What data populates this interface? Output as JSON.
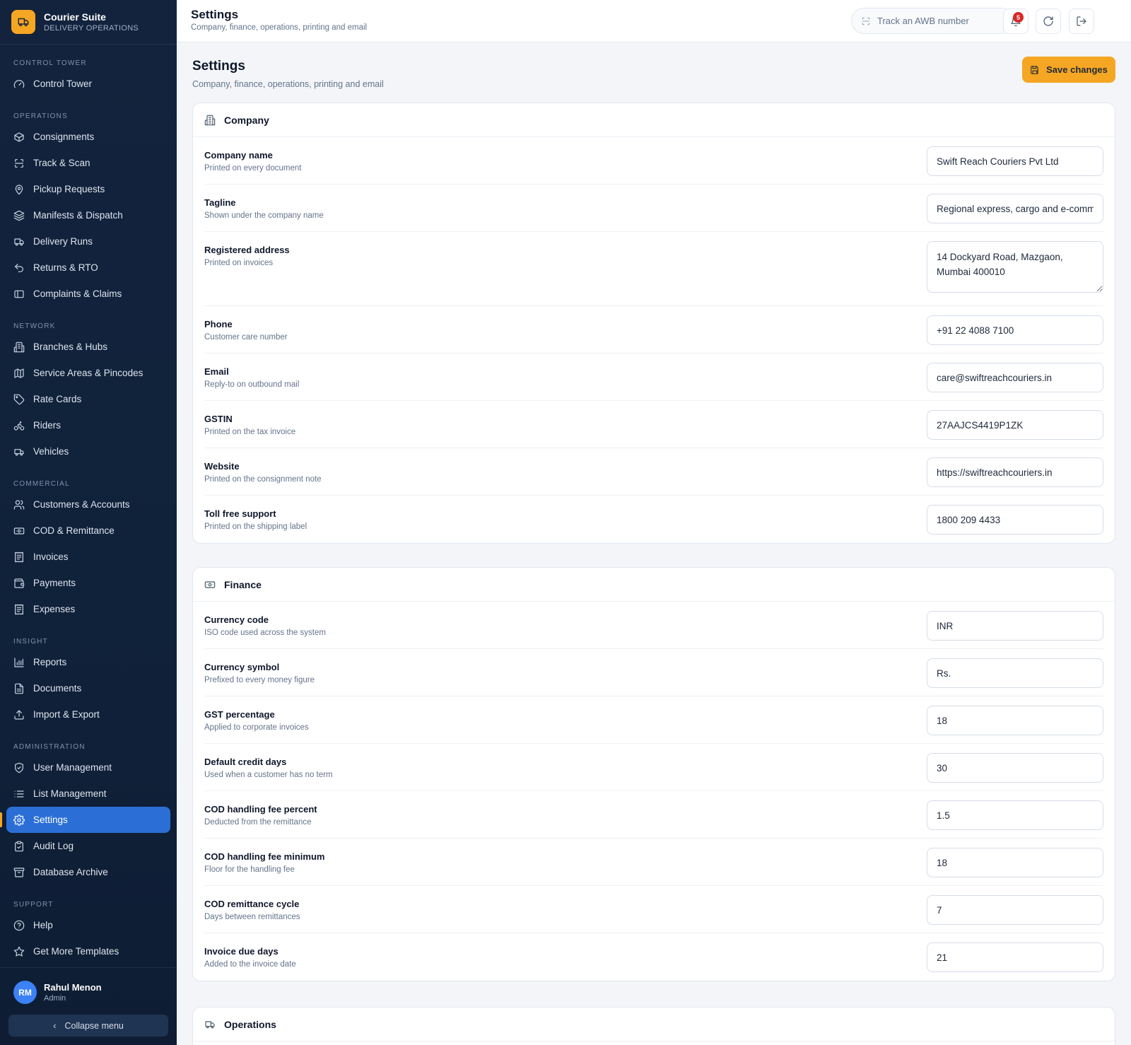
{
  "brand": {
    "name": "Courier Suite",
    "subtitle": "DELIVERY OPERATIONS"
  },
  "nav": {
    "sections": [
      {
        "label": "CONTROL TOWER",
        "items": [
          {
            "label": "Control Tower",
            "icon": "gauge-icon"
          }
        ]
      },
      {
        "label": "OPERATIONS",
        "items": [
          {
            "label": "Consignments",
            "icon": "package-icon"
          },
          {
            "label": "Track & Scan",
            "icon": "scan-icon"
          },
          {
            "label": "Pickup Requests",
            "icon": "map-pin-icon"
          },
          {
            "label": "Manifests & Dispatch",
            "icon": "layers-icon"
          },
          {
            "label": "Delivery Runs",
            "icon": "truck-icon"
          },
          {
            "label": "Returns & RTO",
            "icon": "undo-icon"
          },
          {
            "label": "Complaints & Claims",
            "icon": "ticket-icon"
          }
        ]
      },
      {
        "label": "NETWORK",
        "items": [
          {
            "label": "Branches & Hubs",
            "icon": "building-icon"
          },
          {
            "label": "Service Areas & Pincodes",
            "icon": "map-icon"
          },
          {
            "label": "Rate Cards",
            "icon": "tag-icon"
          },
          {
            "label": "Riders",
            "icon": "bike-icon"
          },
          {
            "label": "Vehicles",
            "icon": "van-icon"
          }
        ]
      },
      {
        "label": "COMMERCIAL",
        "items": [
          {
            "label": "Customers & Accounts",
            "icon": "users-icon"
          },
          {
            "label": "COD & Remittance",
            "icon": "banknote-icon"
          },
          {
            "label": "Invoices",
            "icon": "receipt-icon"
          },
          {
            "label": "Payments",
            "icon": "wallet-icon"
          },
          {
            "label": "Expenses",
            "icon": "receipt-icon"
          }
        ]
      },
      {
        "label": "INSIGHT",
        "items": [
          {
            "label": "Reports",
            "icon": "bar-chart-icon"
          },
          {
            "label": "Documents",
            "icon": "file-icon"
          },
          {
            "label": "Import & Export",
            "icon": "upload-icon"
          }
        ]
      },
      {
        "label": "ADMINISTRATION",
        "items": [
          {
            "label": "User Management",
            "icon": "shield-icon"
          },
          {
            "label": "List Management",
            "icon": "list-icon"
          },
          {
            "label": "Settings",
            "icon": "gear-icon",
            "active": true
          },
          {
            "label": "Audit Log",
            "icon": "clipboard-icon"
          },
          {
            "label": "Database Archive",
            "icon": "archive-icon"
          }
        ]
      },
      {
        "label": "SUPPORT",
        "items": [
          {
            "label": "Help",
            "icon": "help-circle-icon"
          },
          {
            "label": "Get More Templates",
            "icon": "star-icon"
          }
        ]
      }
    ]
  },
  "user": {
    "initials": "RM",
    "name": "Rahul Menon",
    "role": "Admin"
  },
  "collapse_label": "Collapse menu",
  "topbar": {
    "title": "Settings",
    "subtitle": "Company, finance, operations, printing and email",
    "search_placeholder": "Track an AWB number",
    "notification_count": "5"
  },
  "page": {
    "title": "Settings",
    "subtitle": "Company, finance, operations, printing and email",
    "save_label": "Save changes"
  },
  "colors": {
    "accent": "#f5a623",
    "active_nav": "#2b6fd6",
    "sidebar": "#13233d",
    "badge": "#dc2626"
  },
  "company": {
    "title": "Company",
    "fields": [
      {
        "label": "Company name",
        "help": "Printed on every document",
        "value": "Swift Reach Couriers Pvt Ltd"
      },
      {
        "label": "Tagline",
        "help": "Shown under the company name",
        "value": "Regional express, cargo and e-commerce delivery"
      },
      {
        "label": "Registered address",
        "help": "Printed on invoices",
        "value": "14 Dockyard Road, Mazgaon, Mumbai 400010",
        "multiline": true
      },
      {
        "label": "Phone",
        "help": "Customer care number",
        "value": "+91 22 4088 7100"
      },
      {
        "label": "Email",
        "help": "Reply-to on outbound mail",
        "value": "care@swiftreachcouriers.in"
      },
      {
        "label": "GSTIN",
        "help": "Printed on the tax invoice",
        "value": "27AAJCS4419P1ZK"
      },
      {
        "label": "Website",
        "help": "Printed on the consignment note",
        "value": "https://swiftreachcouriers.in"
      },
      {
        "label": "Toll free support",
        "help": "Printed on the shipping label",
        "value": "1800 209 4433"
      }
    ]
  },
  "finance": {
    "title": "Finance",
    "fields": [
      {
        "label": "Currency code",
        "help": "ISO code used across the system",
        "value": "INR"
      },
      {
        "label": "Currency symbol",
        "help": "Prefixed to every money figure",
        "value": "Rs."
      },
      {
        "label": "GST percentage",
        "help": "Applied to corporate invoices",
        "value": "18"
      },
      {
        "label": "Default credit days",
        "help": "Used when a customer has no term",
        "value": "30"
      },
      {
        "label": "COD handling fee percent",
        "help": "Deducted from the remittance",
        "value": "1.5"
      },
      {
        "label": "COD handling fee minimum",
        "help": "Floor for the handling fee",
        "value": "18"
      },
      {
        "label": "COD remittance cycle",
        "help": "Days between remittances",
        "value": "7"
      },
      {
        "label": "Invoice due days",
        "help": "Added to the invoice date",
        "value": "21"
      }
    ]
  },
  "operations": {
    "title": "Operations"
  }
}
